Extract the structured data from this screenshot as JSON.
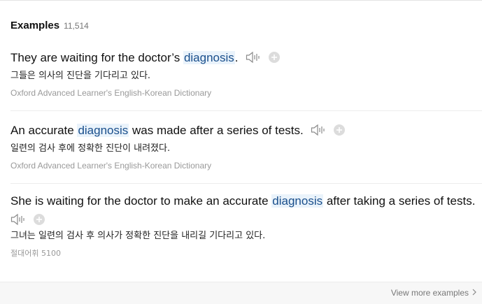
{
  "header": {
    "title": "Examples",
    "count": "11,514"
  },
  "examples": [
    {
      "before": "They are waiting for the doctor’s ",
      "keyword": "diagnosis",
      "after": ".",
      "translation": "그들은 의사의 진단을 기다리고 있다.",
      "source": "Oxford Advanced Learner's English-Korean Dictionary"
    },
    {
      "before": "An accurate ",
      "keyword": "diagnosis",
      "after": " was made after a series of tests.",
      "translation": "일련의 검사 후에 정확한 진단이 내려졌다.",
      "source": "Oxford Advanced Learner's English-Korean Dictionary"
    },
    {
      "before": "She is waiting for the doctor to make an accurate ",
      "keyword": "diagnosis",
      "after": " after taking a series of tests.",
      "translation": "그녀는 일련의 검사 후 의사가 정확한 진단을 내리길 기다리고 있다.",
      "source": "절대어휘 5100"
    }
  ],
  "footer": {
    "view_more": "View more examples"
  },
  "icons": {
    "speaker": "speaker-icon",
    "add": "plus-circle-icon",
    "chevron": "chevron-right-icon"
  },
  "colors": {
    "highlight_bg": "#eaf3fb",
    "keyword": "#1a4f8c",
    "source_text": "#999999"
  }
}
